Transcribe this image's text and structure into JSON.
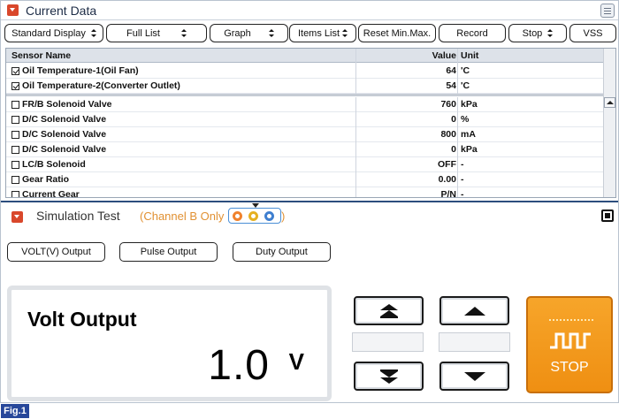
{
  "header": {
    "title": "Current Data"
  },
  "toolbar": {
    "standard_display": "Standard Display",
    "full_list": "Full List",
    "graph": "Graph",
    "items_list": "Items List",
    "reset": "Reset Min.Max.",
    "record": "Record",
    "stop": "Stop",
    "vss": "VSS"
  },
  "table": {
    "headers": {
      "name": "Sensor Name",
      "value": "Value",
      "unit": "Unit"
    },
    "pinned": [
      {
        "name": "Oil Temperature-1(Oil Fan)",
        "value": "64",
        "unit": "'C",
        "checked": true
      },
      {
        "name": "Oil Temperature-2(Converter Outlet)",
        "value": "54",
        "unit": "'C",
        "checked": true
      }
    ],
    "rows": [
      {
        "name": "FR/B Solenoid Valve",
        "value": "760",
        "unit": "kPa",
        "checked": false
      },
      {
        "name": "D/C Solenoid Valve",
        "value": "0",
        "unit": "%",
        "checked": false
      },
      {
        "name": "D/C Solenoid Valve",
        "value": "800",
        "unit": "mA",
        "checked": false
      },
      {
        "name": "D/C Solenoid Valve",
        "value": "0",
        "unit": "kPa",
        "checked": false
      },
      {
        "name": "LC/B Solenoid",
        "value": "OFF",
        "unit": "-",
        "checked": false
      },
      {
        "name": "Gear Ratio",
        "value": "0.00",
        "unit": "-",
        "checked": false
      },
      {
        "name": "Current Gear",
        "value": "P/N",
        "unit": "-",
        "checked": false
      }
    ]
  },
  "simulation": {
    "title": "Simulation Test",
    "note": "(Channel B Only",
    "note_close": ")",
    "channel_colors": [
      "#f0822d",
      "#e5b021",
      "#3f7fd0"
    ]
  },
  "outputs": {
    "volt": "VOLT(V) Output",
    "pulse": "Pulse Output",
    "duty": "Duty Output"
  },
  "volt_display": {
    "title": "Volt Output",
    "value": "1.0",
    "unit": "V"
  },
  "stop_button": {
    "label": "STOP"
  },
  "figure_label": "Fig.1"
}
